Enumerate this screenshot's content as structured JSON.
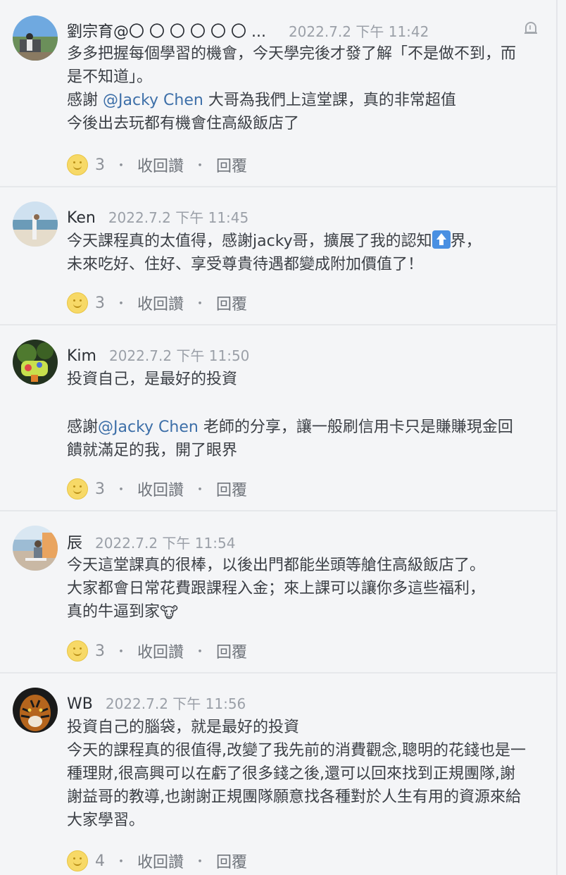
{
  "comments": [
    {
      "name": "劉宗育@〇 〇 〇 〇 〇 〇 ...",
      "time": "2022.7.2 下午 11:42",
      "lines": [
        "多多把握每個學習的機會，今天學完後才發了解「不是做不到，而是不知道」。"
      ],
      "line2_pre": "感謝 ",
      "mention": "@Jacky Chen",
      "line2_post": " 大哥為我們上這堂課，真的非常超值",
      "line3": "今後出去玩都有機會住高級飯店了",
      "likes": "3",
      "unlike": "收回讚",
      "reply": "回覆"
    },
    {
      "name": "Ken",
      "time": "2022.7.2 下午 11:45",
      "line1_pre": "今天課程真的太值得，感謝jacky哥，擴展了我的認知",
      "line1_post": "界，",
      "line2": "未來吃好、住好、享受尊貴待遇都變成附加價值了！",
      "likes": "3",
      "unlike": "收回讚",
      "reply": "回覆"
    },
    {
      "name": "Kim",
      "time": "2022.7.2 下午 11:50",
      "line1": "投資自己，是最好的投資",
      "line2_pre": "感謝",
      "mention": "@Jacky Chen",
      "line2_post": " 老師的分享，讓一般刷信用卡只是賺賺現金回饋就滿足的我，開了眼界",
      "likes": "3",
      "unlike": "收回讚",
      "reply": "回覆"
    },
    {
      "name": "辰",
      "time": "2022.7.2 下午 11:54",
      "line1": "今天這堂課真的很棒，以後出門都能坐頭等艙住高級飯店了。",
      "line2": "大家都會日常花費跟課程入金；來上課可以讓你多這些福利，",
      "line3": "真的牛逼到家",
      "cow": "🐮",
      "likes": "3",
      "unlike": "收回讚",
      "reply": "回覆"
    },
    {
      "name": "WB",
      "time": "2022.7.2 下午 11:56",
      "line1": "投資自己的腦袋，就是最好的投資",
      "line2": "今天的課程真的很值得,改變了我先前的消費觀念,聰明的花錢也是一種理財,很高興可以在虧了很多錢之後,還可以回來找到正規團隊,謝謝益哥的教導,也謝謝正規團隊願意找各種對於人生有用的資源來給大家學習。",
      "likes": "4",
      "unlike": "收回讚",
      "reply": "回覆"
    }
  ],
  "icons": {
    "like": "smile-reaction-icon",
    "bell": "bell-icon",
    "up_emoji": "up-arrow-emoji-icon"
  },
  "colors": {
    "mention": "#3d6fa8",
    "background": "#f4f5f7",
    "timestamp": "#9ba0a8"
  }
}
